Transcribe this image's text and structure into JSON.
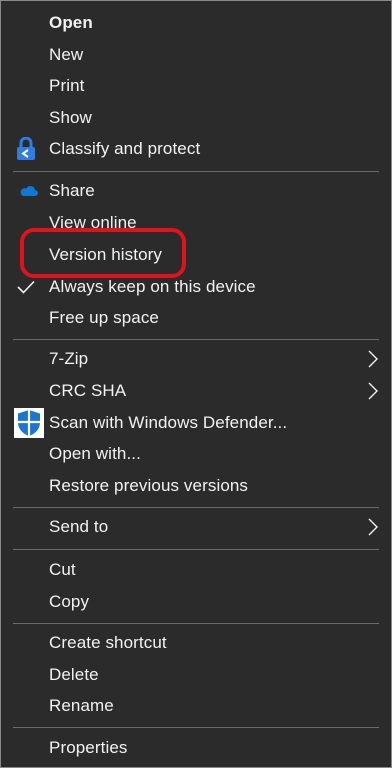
{
  "menu": {
    "items": [
      {
        "id": "open",
        "label": "Open"
      },
      {
        "id": "new",
        "label": "New"
      },
      {
        "id": "print",
        "label": "Print"
      },
      {
        "id": "show",
        "label": "Show"
      },
      {
        "id": "classify",
        "label": "Classify and protect",
        "icon": "classify-protect-icon"
      },
      {
        "id": "share",
        "label": "Share",
        "icon": "onedrive-cloud-icon"
      },
      {
        "id": "view-online",
        "label": "View online"
      },
      {
        "id": "version-history",
        "label": "Version history"
      },
      {
        "id": "always-keep",
        "label": "Always keep on this device",
        "icon": "checkmark-icon"
      },
      {
        "id": "free-up",
        "label": "Free up space"
      },
      {
        "id": "7zip",
        "label": "7-Zip",
        "submenu": true
      },
      {
        "id": "crc-sha",
        "label": "CRC SHA",
        "submenu": true
      },
      {
        "id": "scan-defender",
        "label": "Scan with Windows Defender...",
        "icon": "windows-defender-shield-icon"
      },
      {
        "id": "open-with",
        "label": "Open with..."
      },
      {
        "id": "restore",
        "label": "Restore previous versions"
      },
      {
        "id": "send-to",
        "label": "Send to",
        "submenu": true
      },
      {
        "id": "cut",
        "label": "Cut"
      },
      {
        "id": "copy",
        "label": "Copy"
      },
      {
        "id": "create-shortcut",
        "label": "Create shortcut"
      },
      {
        "id": "delete",
        "label": "Delete"
      },
      {
        "id": "rename",
        "label": "Rename"
      },
      {
        "id": "properties",
        "label": "Properties"
      }
    ]
  },
  "colors": {
    "menu_background": "#2b2b2b",
    "text": "#f2f2f2",
    "separator": "#6a6a6a",
    "highlight_ring": "#e0121c",
    "onedrive_blue": "#0f78d4",
    "defender_blue": "#1e73d6"
  }
}
